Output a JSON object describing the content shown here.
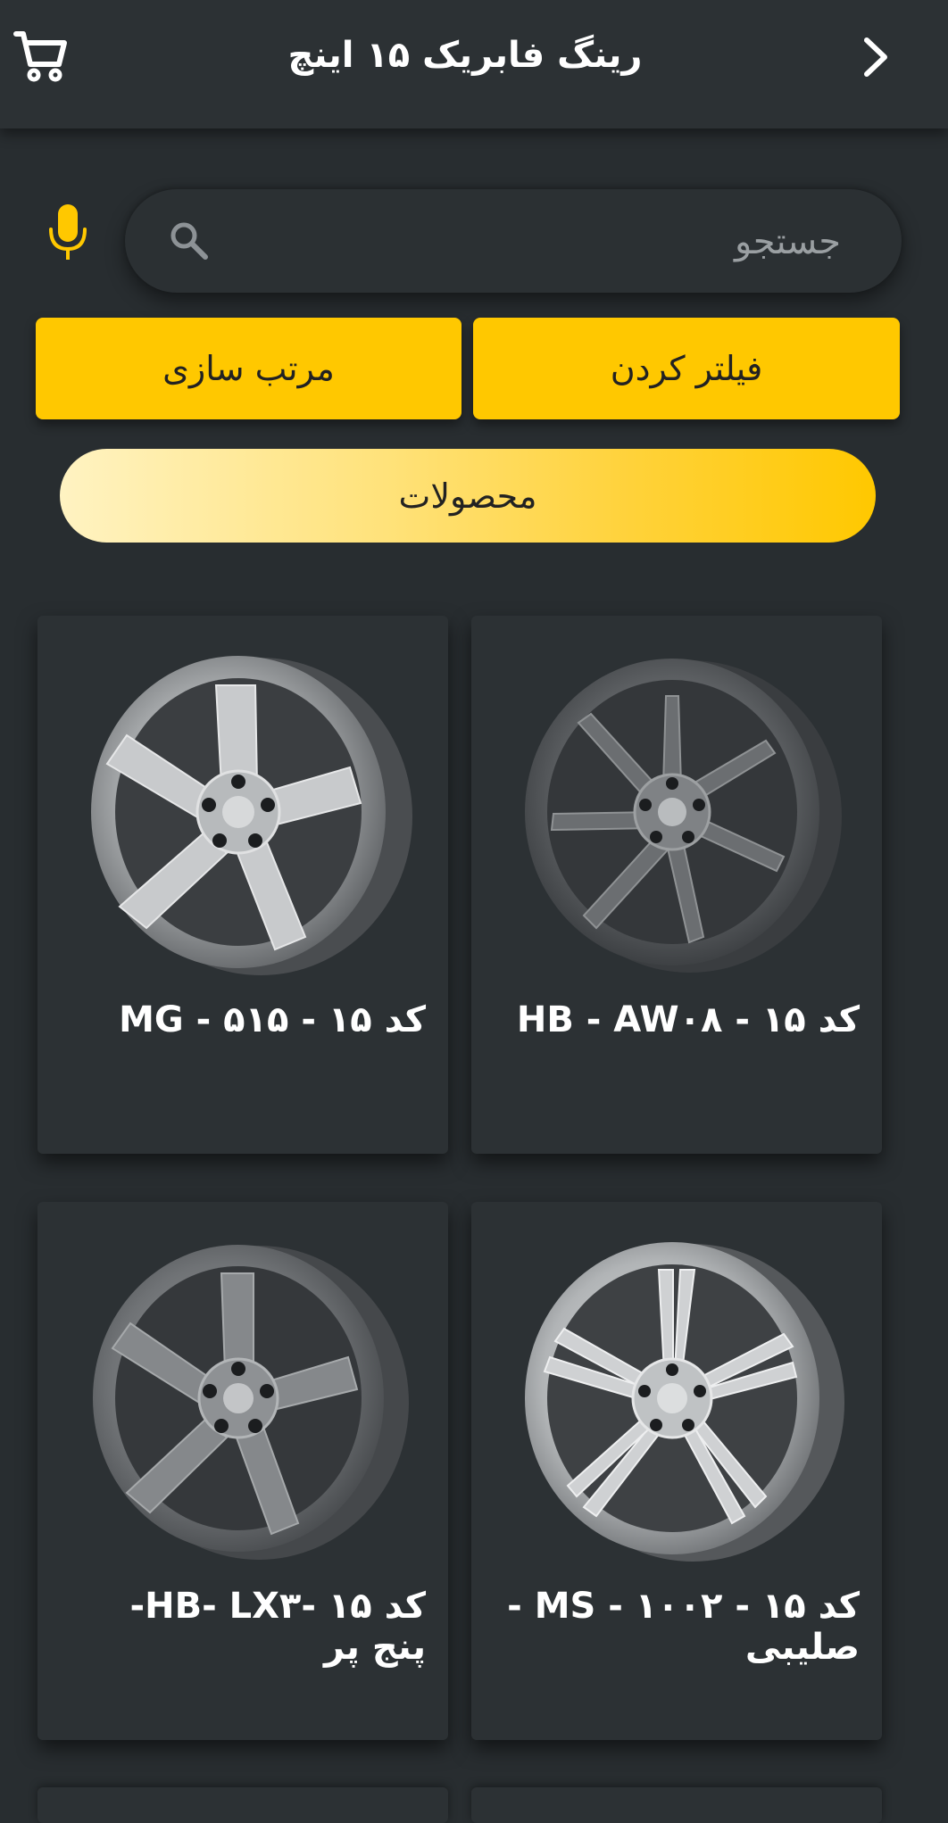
{
  "header": {
    "title": "رینگ فابریک ۱۵ اینچ",
    "cart_icon": "cart-icon",
    "back_icon": "chevron-right-icon"
  },
  "search": {
    "placeholder": "جستجو",
    "search_icon": "search-icon",
    "mic_icon": "microphone-icon"
  },
  "actions": {
    "filter_label": "فیلتر کردن",
    "sort_label": "مرتب سازی"
  },
  "section": {
    "label": "محصولات"
  },
  "products": [
    {
      "title": "کد ۱۵ - HB - AW۰۸",
      "style": "seven-spoke-dark"
    },
    {
      "title": "کد ۱۵ - MG - ۵۱۵",
      "style": "five-spoke-silver"
    },
    {
      "title": "کد ۱۵ - MS - ۱۰۰۲ - صلیبی",
      "style": "split-spoke-silver"
    },
    {
      "title": "کد ۱۵ -HB- LX۳- پنج پر",
      "style": "five-spoke-dark"
    }
  ],
  "colors": {
    "background": "#282d30",
    "card": "#2c3134",
    "accent": "#ffc800",
    "mic": "#ffc800"
  }
}
